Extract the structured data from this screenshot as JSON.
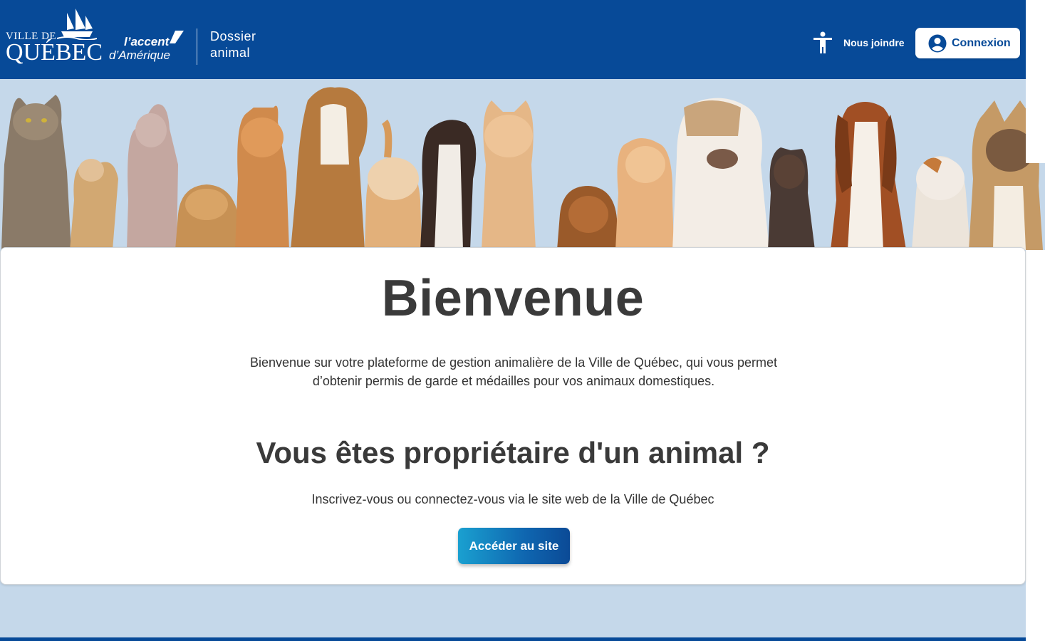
{
  "header": {
    "logo_city": {
      "line1": "Ville de",
      "line2": "Québec"
    },
    "logo_slogan": {
      "line1": "l’accent",
      "line2": "d’Amérique"
    },
    "app_title": {
      "line1": "Dossier",
      "line2": "animal"
    },
    "accessibility_icon": "accessibility-icon",
    "contact_label": "Nous joindre",
    "login_label": "Connexion",
    "login_icon": "user-circle-icon"
  },
  "banner": {
    "image": "cats-and-dogs-banner"
  },
  "main": {
    "title": "Bienvenue",
    "intro": "Bienvenue sur votre plateforme de gestion animalière de la Ville de Québec, qui vous permet d’obtenir permis de garde et médailles pour vos animaux domestiques.",
    "owner_heading": "Vous êtes propriétaire d'un animal ?",
    "owner_text": "Inscrivez-vous ou connectez-vous via le site web de la Ville de Québec",
    "cta_label": "Accéder au site"
  },
  "colors": {
    "brand_blue": "#074a98",
    "banner_bg": "#c5d8ea",
    "text_dark": "#3a3a3a",
    "cta_gradient_start": "#1aa0d0",
    "cta_gradient_end": "#0b4a96"
  }
}
